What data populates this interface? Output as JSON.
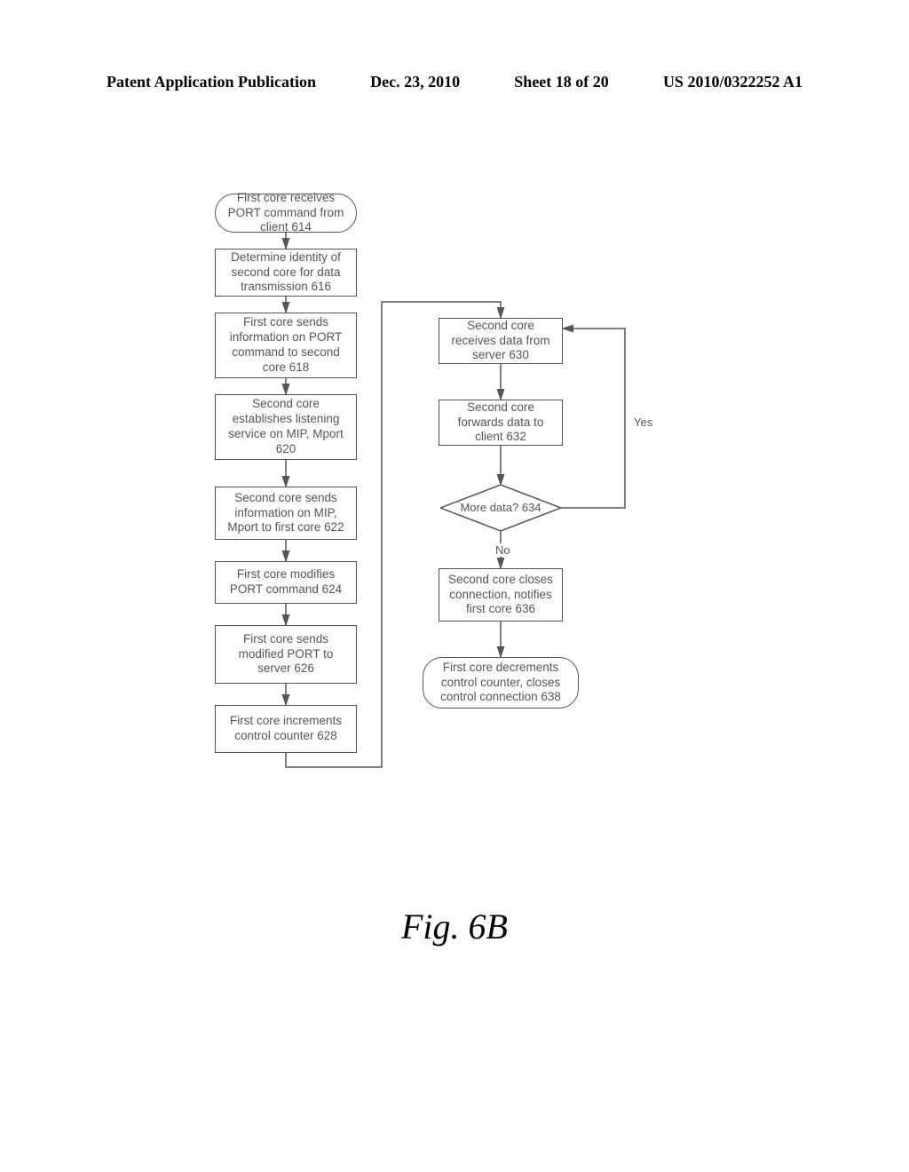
{
  "header": {
    "left": "Patent Application Publication",
    "date": "Dec. 23, 2010",
    "sheet": "Sheet 18 of 20",
    "pubno": "US 2010/0322252 A1"
  },
  "figure_caption": "Fig. 6B",
  "nodes": {
    "n614": "First core receives PORT command from client 614",
    "n616": "Determine identity of second core for data transmission 616",
    "n618": "First core sends information on PORT command to second core 618",
    "n620": "Second core establishes listening service on MIP, Mport 620",
    "n622": "Second core sends information on MIP, Mport to first core 622",
    "n624": "First core modifies PORT command 624",
    "n626": "First core sends modified PORT to server 626",
    "n628": "First core increments control counter 628",
    "n630": "Second core receives data from server 630",
    "n632": "Second core forwards data to client 632",
    "n634": "More data? 634",
    "n636": "Second core closes connection, notifies first core 636",
    "n638": "First core decrements control counter, closes control connection 638"
  },
  "labels": {
    "yes": "Yes",
    "no": "No"
  }
}
